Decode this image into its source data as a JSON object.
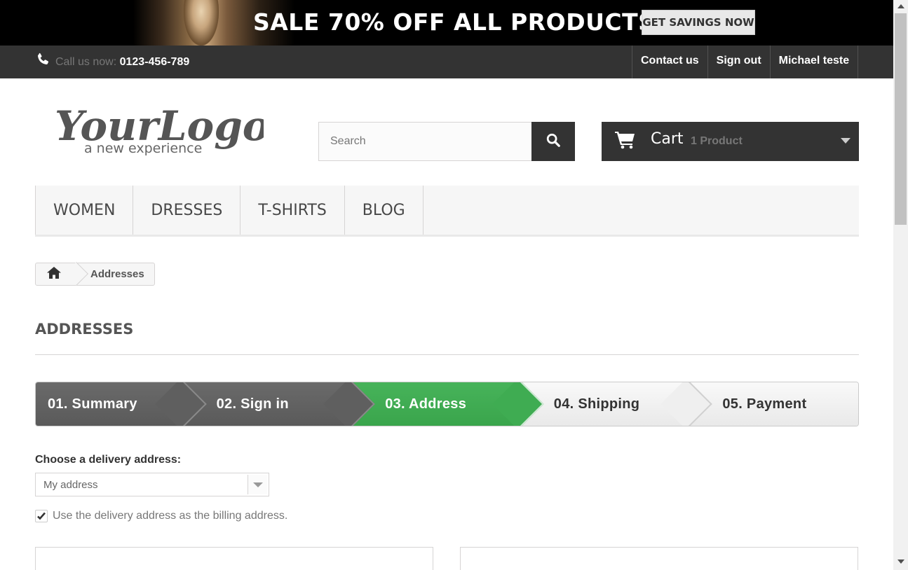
{
  "banner": {
    "headline": "SALE 70% OFF ALL PRODUCTS",
    "cta_label": "GET SAVINGS NOW"
  },
  "topnav": {
    "call_prefix": "Call us now: ",
    "phone_number": "0123-456-789",
    "links": [
      "Contact us",
      "Sign out",
      "Michael teste"
    ]
  },
  "header": {
    "logo_text": "YourLogo",
    "logo_tagline": "a new experience",
    "search_placeholder": "Search",
    "cart_label": "Cart",
    "cart_count": "1 Product"
  },
  "menu": {
    "items": [
      "WOMEN",
      "DRESSES",
      "T-SHIRTS",
      "BLOG"
    ]
  },
  "breadcrumb": {
    "current": "Addresses"
  },
  "page": {
    "title": "ADDRESSES"
  },
  "steps": [
    {
      "label": "01. Summary",
      "state": "done"
    },
    {
      "label": "02. Sign in",
      "state": "done"
    },
    {
      "label": "03. Address",
      "state": "current"
    },
    {
      "label": "04. Shipping",
      "state": "todo"
    },
    {
      "label": "05. Payment",
      "state": "todo"
    }
  ],
  "form": {
    "choose_label": "Choose a delivery address:",
    "selected_address": "My address",
    "same_billing_label": "Use the delivery address as the billing address.",
    "same_billing_checked": true
  },
  "colors": {
    "dark": "#333333",
    "step_done": "#5f5f5f",
    "step_current": "#3fac52",
    "step_todo": "#efefef"
  }
}
